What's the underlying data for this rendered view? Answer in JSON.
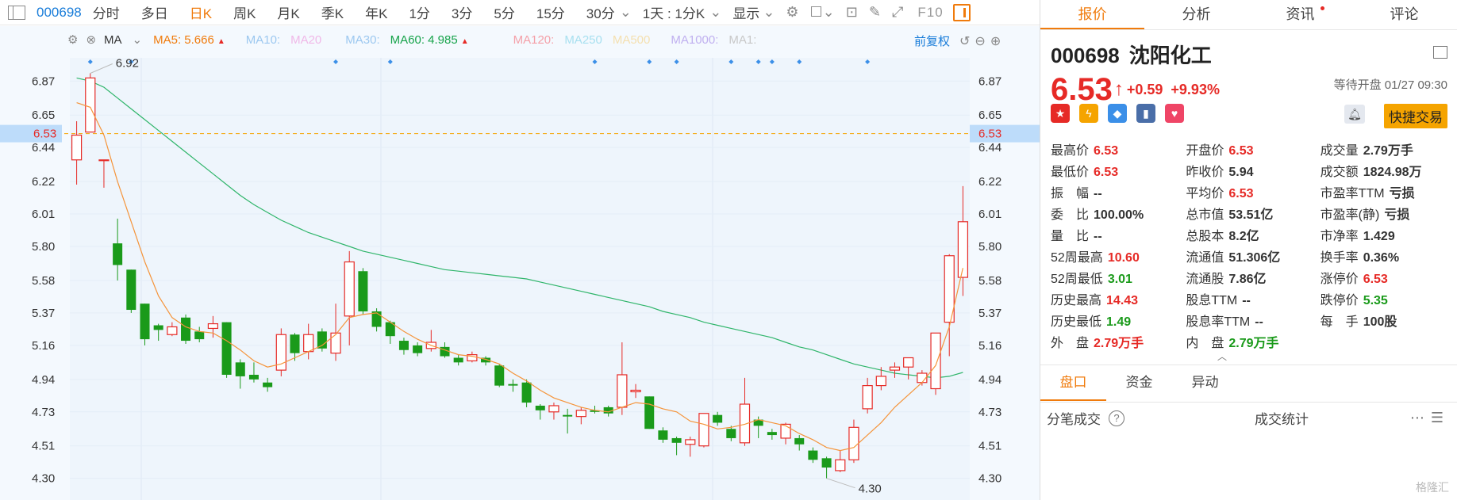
{
  "toolbar": {
    "code": "000698",
    "tabs": [
      "分时",
      "多日",
      "日K",
      "周K",
      "月K",
      "季K",
      "年K",
      "1分",
      "3分",
      "5分",
      "15分",
      "30分"
    ],
    "active_tab": "日K",
    "period_select": "1天 : 1分K",
    "display_label": "显示",
    "f10": "F10"
  },
  "ma_bar": {
    "ma_label": "MA",
    "ma5": "MA5: 5.666",
    "ma10": "MA10:",
    "ma20": "MA20",
    "ma30": "MA30:",
    "ma60": "MA60: 4.985",
    "ma120": "MA120:",
    "ma250": "MA250",
    "ma500": "MA500",
    "ma1000": "MA1000:",
    "ma1": "MA1:",
    "adjust": "前复权",
    "colors": {
      "ma5": "#f07b0c",
      "ma10": "#9cc8f0",
      "ma20": "#f0b8e8",
      "ma30": "#9cc8f0",
      "ma60": "#16a34a",
      "ma120": "#f4a0a8",
      "ma250": "#a8e0f0",
      "ma500": "#f4e0b0",
      "ma1000": "#c0b0f0",
      "ma1": "#c8c8c8"
    }
  },
  "chart": {
    "y_ticks": [
      "6.87",
      "6.65",
      "6.44",
      "6.22",
      "6.01",
      "5.80",
      "5.58",
      "5.37",
      "5.16",
      "4.94",
      "4.73",
      "4.51",
      "4.30"
    ],
    "current_price": "6.53",
    "high_label": "6.92",
    "low_label": "4.30"
  },
  "chart_data": {
    "type": "candlestick",
    "up_color": "#e62a26",
    "down_color": "#1a9a1a",
    "ylim": [
      4.16,
      7.02
    ],
    "reference_line": 6.53,
    "candles": [
      [
        6.36,
        6.52,
        6.2,
        6.61
      ],
      [
        6.54,
        6.89,
        6.54,
        6.92
      ],
      [
        6.36,
        6.36,
        6.18,
        6.36
      ],
      [
        5.82,
        5.68,
        5.58,
        5.98
      ],
      [
        5.65,
        5.39,
        5.37,
        5.65
      ],
      [
        5.43,
        5.2,
        5.16,
        5.43
      ],
      [
        5.29,
        5.26,
        5.19,
        5.3
      ],
      [
        5.23,
        5.28,
        5.22,
        5.31
      ],
      [
        5.34,
        5.19,
        5.17,
        5.36
      ],
      [
        5.25,
        5.2,
        5.18,
        5.28
      ],
      [
        5.27,
        5.3,
        5.21,
        5.35
      ],
      [
        5.31,
        4.97,
        4.95,
        5.31
      ],
      [
        5.05,
        4.96,
        4.88,
        5.07
      ],
      [
        4.97,
        4.94,
        4.92,
        5.05
      ],
      [
        4.92,
        4.89,
        4.86,
        4.95
      ],
      [
        5.0,
        5.23,
        4.96,
        5.27
      ],
      [
        5.23,
        5.11,
        5.06,
        5.24
      ],
      [
        5.12,
        5.23,
        5.07,
        5.3
      ],
      [
        5.25,
        5.14,
        5.12,
        5.27
      ],
      [
        5.11,
        5.24,
        5.06,
        5.43
      ],
      [
        5.35,
        5.7,
        5.16,
        5.77
      ],
      [
        5.64,
        5.38,
        5.36,
        5.66
      ],
      [
        5.38,
        5.28,
        5.25,
        5.4
      ],
      [
        5.31,
        5.22,
        5.17,
        5.32
      ],
      [
        5.19,
        5.13,
        5.1,
        5.21
      ],
      [
        5.16,
        5.11,
        5.09,
        5.18
      ],
      [
        5.14,
        5.18,
        5.12,
        5.26
      ],
      [
        5.15,
        5.09,
        5.08,
        5.18
      ],
      [
        5.08,
        5.05,
        5.03,
        5.1
      ],
      [
        5.06,
        5.1,
        5.05,
        5.12
      ],
      [
        5.08,
        5.05,
        5.03,
        5.09
      ],
      [
        5.03,
        4.9,
        4.89,
        5.04
      ],
      [
        4.91,
        4.9,
        4.86,
        4.94
      ],
      [
        4.92,
        4.79,
        4.76,
        4.94
      ],
      [
        4.77,
        4.74,
        4.68,
        4.78
      ],
      [
        4.73,
        4.77,
        4.68,
        4.79
      ],
      [
        4.71,
        4.7,
        4.59,
        4.75
      ],
      [
        4.7,
        4.74,
        4.65,
        4.76
      ],
      [
        4.74,
        4.73,
        4.72,
        4.77
      ],
      [
        4.76,
        4.72,
        4.7,
        4.77
      ],
      [
        4.76,
        4.97,
        4.71,
        5.18
      ],
      [
        4.86,
        4.87,
        4.82,
        4.91
      ],
      [
        4.83,
        4.62,
        4.62,
        4.83
      ],
      [
        4.61,
        4.55,
        4.53,
        4.63
      ],
      [
        4.56,
        4.53,
        4.45,
        4.57
      ],
      [
        4.52,
        4.55,
        4.44,
        4.57
      ],
      [
        4.51,
        4.72,
        4.5,
        4.72
      ],
      [
        4.71,
        4.66,
        4.64,
        4.73
      ],
      [
        4.62,
        4.56,
        4.54,
        4.64
      ],
      [
        4.53,
        4.78,
        4.51,
        4.95
      ],
      [
        4.68,
        4.64,
        4.56,
        4.7
      ],
      [
        4.6,
        4.58,
        4.55,
        4.62
      ],
      [
        4.56,
        4.65,
        4.52,
        4.66
      ],
      [
        4.56,
        4.52,
        4.48,
        4.58
      ],
      [
        4.48,
        4.42,
        4.4,
        4.5
      ],
      [
        4.43,
        4.37,
        4.3,
        4.44
      ],
      [
        4.35,
        4.42,
        4.34,
        4.48
      ],
      [
        4.42,
        4.63,
        4.4,
        4.68
      ],
      [
        4.75,
        4.9,
        4.72,
        4.95
      ],
      [
        4.9,
        4.96,
        4.87,
        5.02
      ],
      [
        5.0,
        5.02,
        4.95,
        5.05
      ],
      [
        5.02,
        5.08,
        4.94,
        5.04
      ],
      [
        4.92,
        4.98,
        4.9,
        5.0
      ],
      [
        4.88,
        5.24,
        4.84,
        5.24
      ],
      [
        5.31,
        5.74,
        5.09,
        5.75
      ],
      [
        5.6,
        5.96,
        5.48,
        6.19
      ]
    ],
    "ma5": [
      [
        0,
        6.73
      ],
      [
        1,
        6.7
      ],
      [
        2,
        6.52
      ],
      [
        3,
        6.22
      ],
      [
        4,
        5.96
      ],
      [
        5,
        5.7
      ],
      [
        6,
        5.48
      ],
      [
        7,
        5.34
      ],
      [
        8,
        5.28
      ],
      [
        9,
        5.25
      ],
      [
        10,
        5.24
      ],
      [
        11,
        5.19
      ],
      [
        12,
        5.13
      ],
      [
        13,
        5.06
      ],
      [
        14,
        5.02
      ],
      [
        15,
        5.04
      ],
      [
        16,
        5.08
      ],
      [
        17,
        5.12
      ],
      [
        18,
        5.16
      ],
      [
        19,
        5.23
      ],
      [
        20,
        5.34
      ],
      [
        21,
        5.36
      ],
      [
        22,
        5.37
      ],
      [
        23,
        5.31
      ],
      [
        24,
        5.25
      ],
      [
        25,
        5.2
      ],
      [
        26,
        5.16
      ],
      [
        27,
        5.13
      ],
      [
        28,
        5.1
      ],
      [
        29,
        5.09
      ],
      [
        30,
        5.07
      ],
      [
        31,
        5.04
      ],
      [
        32,
        4.98
      ],
      [
        33,
        4.93
      ],
      [
        34,
        4.87
      ],
      [
        35,
        4.82
      ],
      [
        36,
        4.79
      ],
      [
        37,
        4.76
      ],
      [
        38,
        4.74
      ],
      [
        39,
        4.73
      ],
      [
        40,
        4.76
      ],
      [
        41,
        4.79
      ],
      [
        42,
        4.78
      ],
      [
        43,
        4.75
      ],
      [
        44,
        4.73
      ],
      [
        45,
        4.67
      ],
      [
        46,
        4.65
      ],
      [
        47,
        4.62
      ],
      [
        48,
        4.63
      ],
      [
        49,
        4.65
      ],
      [
        50,
        4.68
      ],
      [
        51,
        4.66
      ],
      [
        52,
        4.64
      ],
      [
        53,
        4.59
      ],
      [
        54,
        4.55
      ],
      [
        55,
        4.5
      ],
      [
        56,
        4.48
      ],
      [
        57,
        4.5
      ],
      [
        58,
        4.58
      ],
      [
        59,
        4.66
      ],
      [
        60,
        4.76
      ],
      [
        61,
        4.84
      ],
      [
        62,
        4.92
      ],
      [
        63,
        5.03
      ],
      [
        64,
        5.28
      ],
      [
        65,
        5.66
      ]
    ],
    "ma60": [
      [
        0,
        6.89
      ],
      [
        1,
        6.87
      ],
      [
        2,
        6.83
      ],
      [
        3,
        6.76
      ],
      [
        4,
        6.69
      ],
      [
        5,
        6.62
      ],
      [
        6,
        6.55
      ],
      [
        7,
        6.48
      ],
      [
        8,
        6.41
      ],
      [
        9,
        6.34
      ],
      [
        10,
        6.27
      ],
      [
        11,
        6.2
      ],
      [
        12,
        6.13
      ],
      [
        13,
        6.07
      ],
      [
        14,
        6.02
      ],
      [
        15,
        5.97
      ],
      [
        16,
        5.93
      ],
      [
        17,
        5.89
      ],
      [
        18,
        5.86
      ],
      [
        19,
        5.83
      ],
      [
        20,
        5.8
      ],
      [
        21,
        5.77
      ],
      [
        22,
        5.75
      ],
      [
        23,
        5.73
      ],
      [
        24,
        5.71
      ],
      [
        25,
        5.69
      ],
      [
        26,
        5.67
      ],
      [
        27,
        5.65
      ],
      [
        28,
        5.64
      ],
      [
        29,
        5.63
      ],
      [
        30,
        5.62
      ],
      [
        31,
        5.61
      ],
      [
        32,
        5.6
      ],
      [
        33,
        5.59
      ],
      [
        34,
        5.57
      ],
      [
        35,
        5.55
      ],
      [
        36,
        5.53
      ],
      [
        37,
        5.51
      ],
      [
        38,
        5.49
      ],
      [
        39,
        5.47
      ],
      [
        40,
        5.45
      ],
      [
        41,
        5.43
      ],
      [
        42,
        5.41
      ],
      [
        43,
        5.38
      ],
      [
        44,
        5.36
      ],
      [
        45,
        5.34
      ],
      [
        46,
        5.31
      ],
      [
        47,
        5.29
      ],
      [
        48,
        5.27
      ],
      [
        49,
        5.25
      ],
      [
        50,
        5.23
      ],
      [
        51,
        5.21
      ],
      [
        52,
        5.18
      ],
      [
        53,
        5.15
      ],
      [
        54,
        5.13
      ],
      [
        55,
        5.1
      ],
      [
        56,
        5.07
      ],
      [
        57,
        5.04
      ],
      [
        58,
        5.02
      ],
      [
        59,
        5.0
      ],
      [
        60,
        4.98
      ],
      [
        61,
        4.97
      ],
      [
        62,
        4.96
      ],
      [
        63,
        4.95
      ],
      [
        64,
        4.96
      ],
      [
        65,
        4.985
      ]
    ],
    "high_marker": {
      "index": 1,
      "value": 6.92
    },
    "low_marker": {
      "index": 55,
      "value": 4.3
    },
    "event_markers": [
      1,
      4,
      19,
      23,
      38,
      42,
      44,
      48,
      50,
      51,
      53,
      58
    ]
  },
  "panel": {
    "tabs": [
      "报价",
      "分析",
      "资讯",
      "评论"
    ],
    "active": "报价",
    "code": "000698",
    "name": "沈阳化工",
    "price": "6.53",
    "change": "+0.59",
    "change_pct": "+9.93%",
    "status": "等待开盘 01/27 09:30",
    "trade_button": "快捷交易",
    "quote_rows": [
      [
        [
          "最高价",
          "6.53",
          "red"
        ],
        [
          "开盘价",
          "6.53",
          "red"
        ],
        [
          "成交量",
          "2.79万手",
          "grey"
        ]
      ],
      [
        [
          "最低价",
          "6.53",
          "red"
        ],
        [
          "昨收价",
          "5.94",
          "grey"
        ],
        [
          "成交额",
          "1824.98万",
          "grey"
        ]
      ],
      [
        [
          "振　幅",
          "--",
          "grey"
        ],
        [
          "平均价",
          "6.53",
          "red"
        ],
        [
          "市盈率TTM",
          "亏损",
          "grey"
        ]
      ],
      [
        [
          "委　比",
          "100.00%",
          "grey"
        ],
        [
          "总市值",
          "53.51亿",
          "grey"
        ],
        [
          "市盈率(静)",
          "亏损",
          "grey"
        ]
      ],
      [
        [
          "量　比",
          "--",
          "grey"
        ],
        [
          "总股本",
          "8.2亿",
          "grey"
        ],
        [
          "市净率",
          "1.429",
          "grey"
        ]
      ],
      [
        [
          "52周最高",
          "10.60",
          "red"
        ],
        [
          "流通值",
          "51.306亿",
          "grey"
        ],
        [
          "换手率",
          "0.36%",
          "grey"
        ]
      ],
      [
        [
          "52周最低",
          "3.01",
          "green"
        ],
        [
          "流通股",
          "7.86亿",
          "grey"
        ],
        [
          "涨停价",
          "6.53",
          "red"
        ]
      ],
      [
        [
          "历史最高",
          "14.43",
          "red"
        ],
        [
          "股息TTM",
          "--",
          "grey"
        ],
        [
          "跌停价",
          "5.35",
          "green"
        ]
      ],
      [
        [
          "历史最低",
          "1.49",
          "green"
        ],
        [
          "股息率TTM",
          "--",
          "grey"
        ],
        [
          "每　手",
          "100股",
          "grey"
        ]
      ],
      [
        [
          "外　盘",
          "2.79万手",
          "red"
        ],
        [
          "内　盘",
          "2.79万手",
          "green"
        ],
        [
          "",
          "",
          ""
        ]
      ]
    ],
    "sub_tabs": [
      "盘口",
      "资金",
      "异动"
    ],
    "sub_active": "盘口",
    "tick_label": "分笔成交",
    "stats_label": "成交统计",
    "watermark": "格隆汇"
  }
}
